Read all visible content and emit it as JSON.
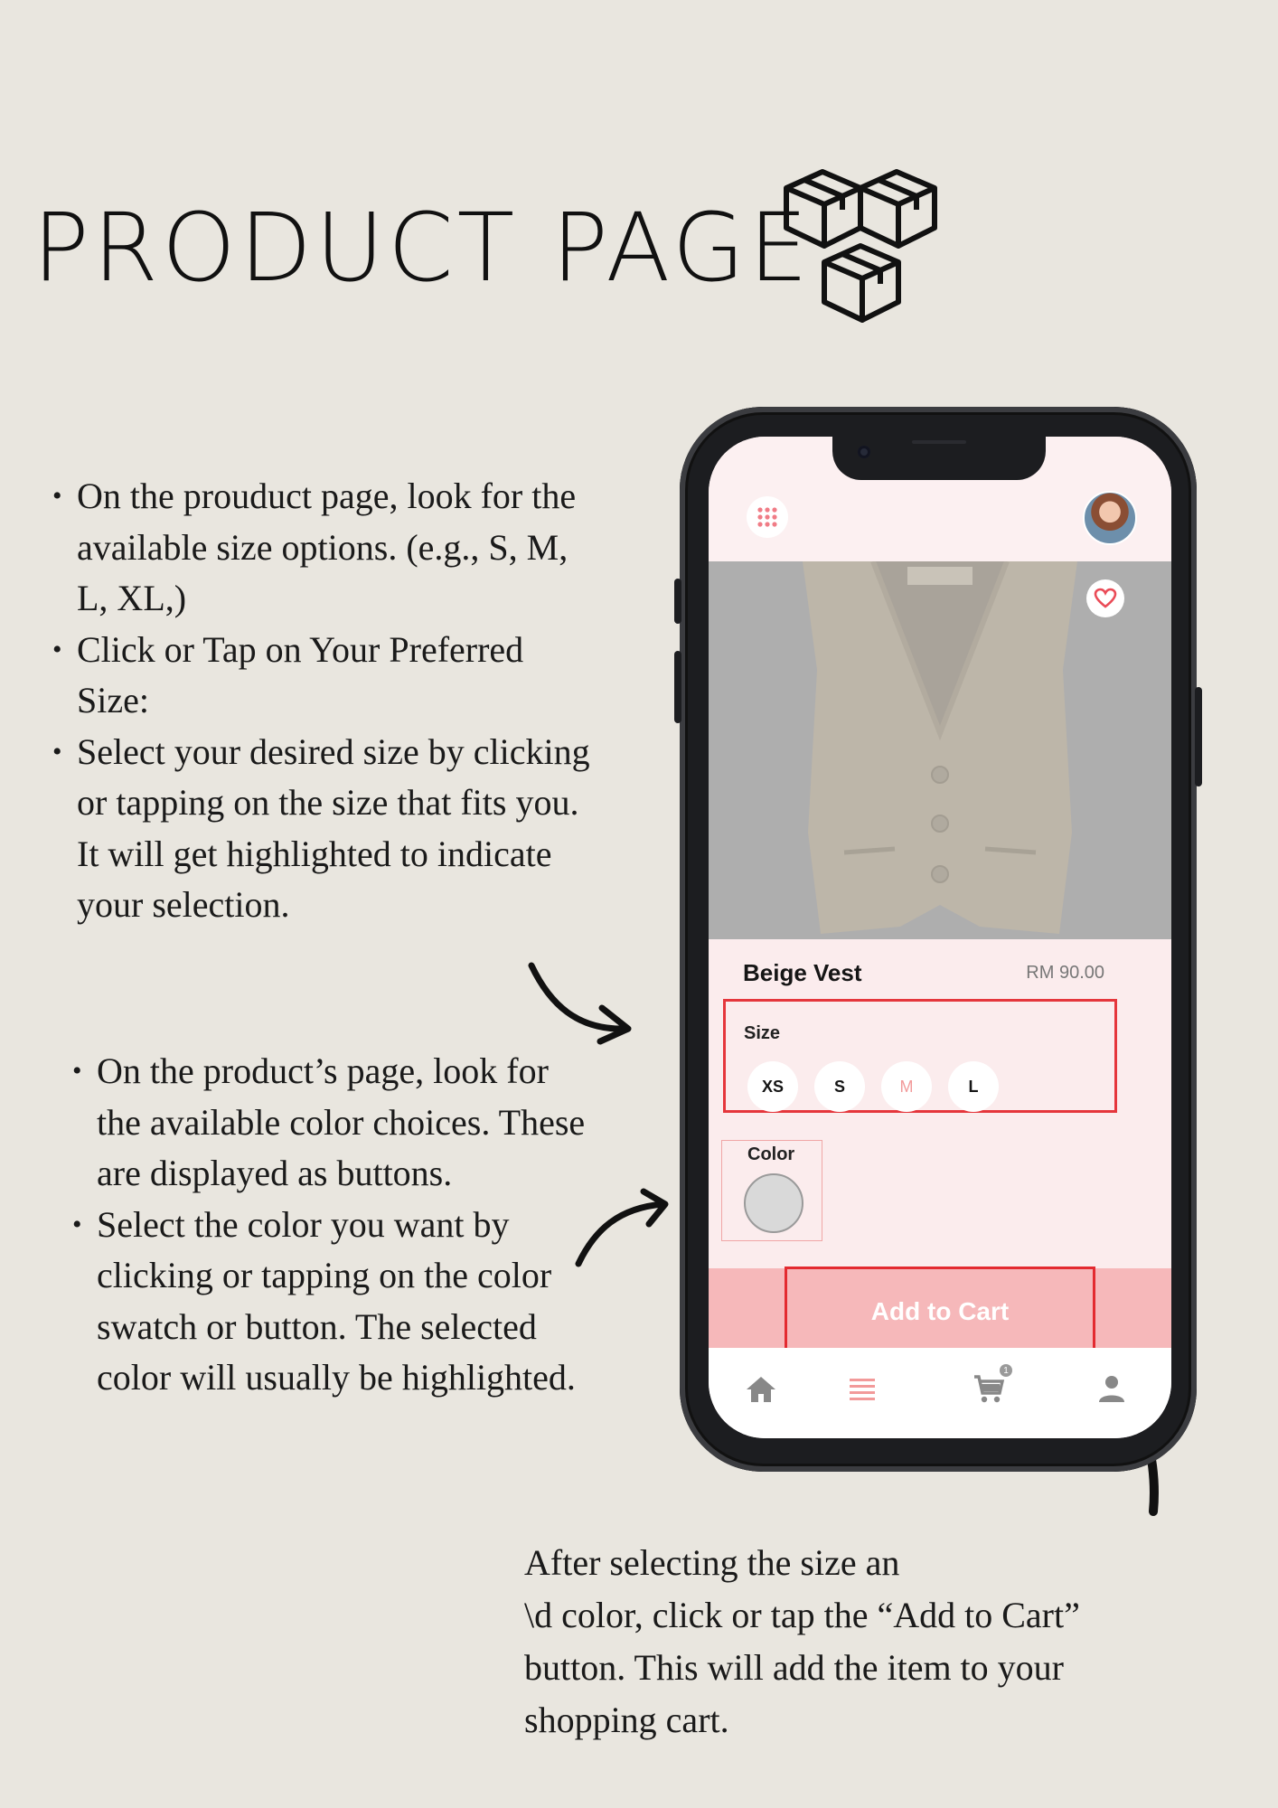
{
  "page": {
    "title": "PRODUCT PAGE",
    "background_color": "#e9e6df",
    "title_icon": "boxes-icon"
  },
  "instructions": {
    "size_bullets": [
      "On the prouduct page, look for the available size options.  (e.g., S, M, L, XL,)",
      "Click or Tap on Your Preferred Size:",
      "Select your desired size by clicking or tapping on the size that fits you. It will get highlighted to indicate your selection."
    ],
    "color_bullets": [
      "On the product’s page, look for the available color choices. These are  displayed as buttons.",
      "Select the color you want by clicking or tapping on the color swatch or button. The selected color will usually be highlighted."
    ],
    "after_lines": [
      "After selecting the size an",
      "\\d color, click or tap the “Add to Cart”",
      "button. This will add the item to your",
      "shopping cart."
    ]
  },
  "app": {
    "menu_icon": "grid-icon",
    "avatar_icon": "avatar",
    "favorite_icon": "heart-icon",
    "product_name": "Beige Vest",
    "price": "RM 90.00",
    "size_label": "Size",
    "sizes": [
      "XS",
      "S",
      "M",
      "L"
    ],
    "selected_size": "M",
    "color_label": "Color",
    "color_swatch": "#d9d9d9",
    "add_to_cart": "Add to Cart",
    "cart_badge": "1",
    "tabs": [
      "home-icon",
      "list-icon",
      "cart-icon",
      "profile-icon"
    ],
    "accent_color": "#f6b8ba",
    "highlight_color": "#e5363c"
  }
}
